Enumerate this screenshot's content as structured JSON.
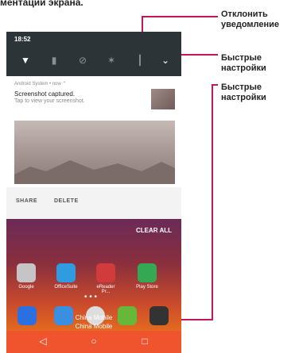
{
  "page": {
    "top_text": "ментации экрана."
  },
  "callouts": {
    "dismiss": "Отклонить\nуведомление",
    "quick1": "Быстрые\nнастройки",
    "quick2": "Быстрые\nнастройки"
  },
  "statusbar": {
    "time": "18:52"
  },
  "notification": {
    "app": "Android System • now ⌃",
    "title": "Screenshot captured.",
    "subtitle": "Tap to view your screenshot.",
    "share_label": "SHARE",
    "delete_label": "DELETE"
  },
  "home": {
    "clear_all": "CLEAR ALL",
    "apps": [
      {
        "label": "Google",
        "color": "#c5c5c5"
      },
      {
        "label": "OfficeSuite",
        "color": "#2f9be0"
      },
      {
        "label": "eReader Pr...",
        "color": "#d23b3b"
      },
      {
        "label": "Play Store",
        "color": "#34a853"
      }
    ],
    "dots": "• • •",
    "carrier1": "China Mobile",
    "carrier2": "China Mobile"
  },
  "navbar": {
    "back": "◁",
    "home": "○",
    "recents": "□"
  },
  "colors": {
    "accent": "#c2185b",
    "statusbar": "#2d3438",
    "navbar": "#f0542f"
  }
}
